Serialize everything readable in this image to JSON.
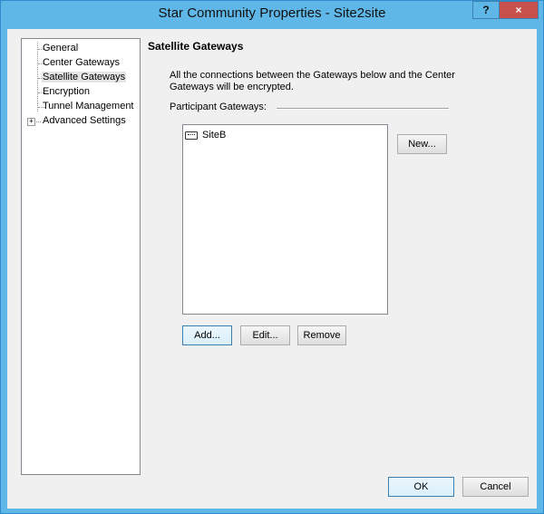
{
  "window": {
    "title": "Star Community Properties - Site2site",
    "help_label": "?",
    "close_label": "×"
  },
  "tree": {
    "items": [
      {
        "label": "General"
      },
      {
        "label": "Center Gateways"
      },
      {
        "label": "Satellite Gateways",
        "selected": true
      },
      {
        "label": "Encryption"
      },
      {
        "label": "Tunnel Management"
      },
      {
        "label": "Advanced Settings",
        "expander": "+"
      }
    ]
  },
  "content": {
    "section_title": "Satellite Gateways",
    "description": "All the connections between the Gateways below and the Center Gateways will be encrypted.",
    "participant_label": "Participant Gateways:",
    "participants": [
      {
        "name": "SiteB",
        "icon": "gateway-icon"
      }
    ],
    "new_button": "New...",
    "add_button": "Add...",
    "edit_button": "Edit...",
    "remove_button": "Remove"
  },
  "footer": {
    "ok_button": "OK",
    "cancel_button": "Cancel"
  },
  "colors": {
    "title_bar": "#5fb7e8",
    "close_button": "#c7504c",
    "dialog_bg": "#f0f0f0"
  }
}
